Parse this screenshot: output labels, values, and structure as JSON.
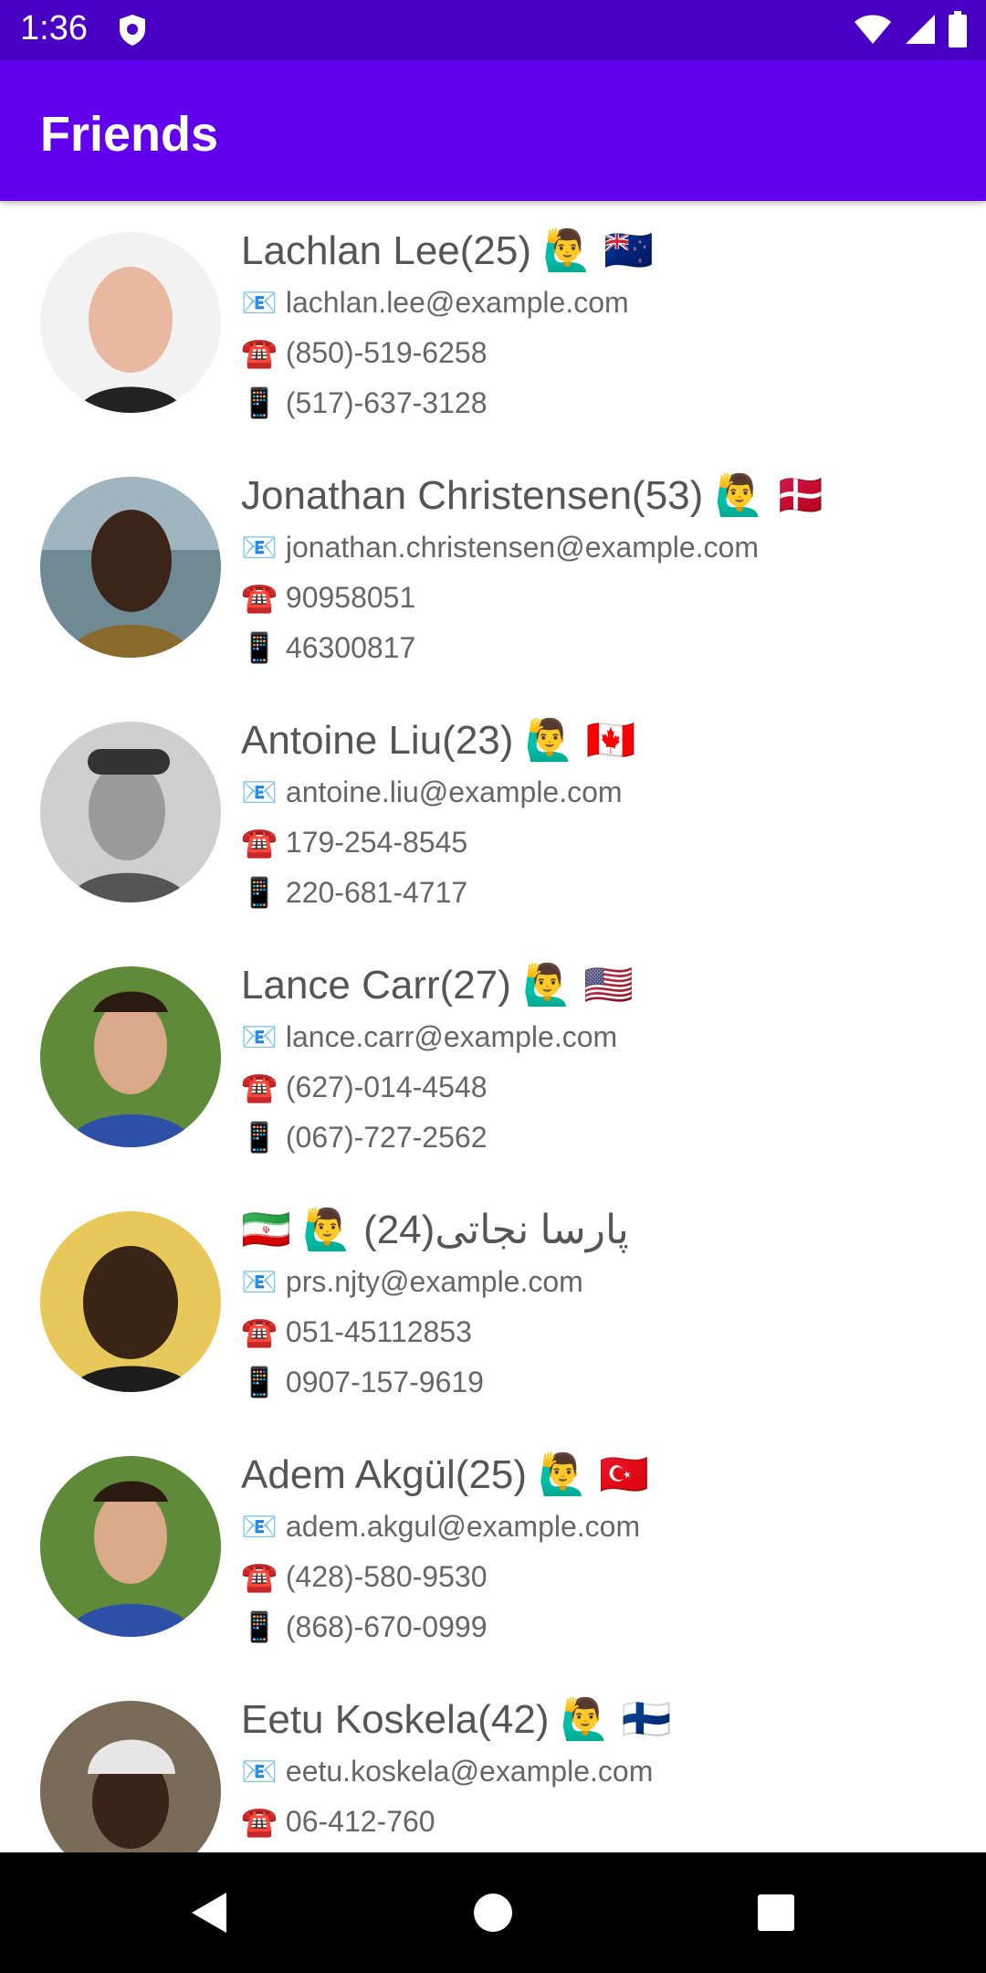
{
  "status_bar": {
    "time": "1:36"
  },
  "app_bar": {
    "title": "Friends"
  },
  "icons": {
    "email": "📧",
    "phone": "☎️",
    "mobile": "📱",
    "person_raising_hand": "🙋‍♂️"
  },
  "friends": [
    {
      "name_age": "Lachlan Lee(25)",
      "flag": "🇳🇿",
      "email": "lachlan.lee@example.com",
      "phone": "(850)-519-6258",
      "cell": "(517)-637-3128"
    },
    {
      "name_age": "Jonathan Christensen(53)",
      "flag": "🇩🇰",
      "email": "jonathan.christensen@example.com",
      "phone": "90958051",
      "cell": "46300817"
    },
    {
      "name_age": "Antoine Liu(23)",
      "flag": "🇨🇦",
      "email": "antoine.liu@example.com",
      "phone": "179-254-8545",
      "cell": "220-681-4717"
    },
    {
      "name_age": "Lance Carr(27)",
      "flag": "🇺🇸",
      "email": "lance.carr@example.com",
      "phone": "(627)-014-4548",
      "cell": "(067)-727-2562"
    },
    {
      "name_age": "پارسا نجاتی(24)",
      "flag": "🇮🇷",
      "email": "prs.njty@example.com",
      "phone": "051-45112853",
      "cell": "0907-157-9619"
    },
    {
      "name_age": "Adem Akgül(25)",
      "flag": "🇹🇷",
      "email": "adem.akgul@example.com",
      "phone": "(428)-580-9530",
      "cell": "(868)-670-0999"
    },
    {
      "name_age": "Eetu Koskela(42)",
      "flag": "🇫🇮",
      "email": "eetu.koskela@example.com",
      "phone": "06-412-760",
      "cell": ""
    }
  ]
}
